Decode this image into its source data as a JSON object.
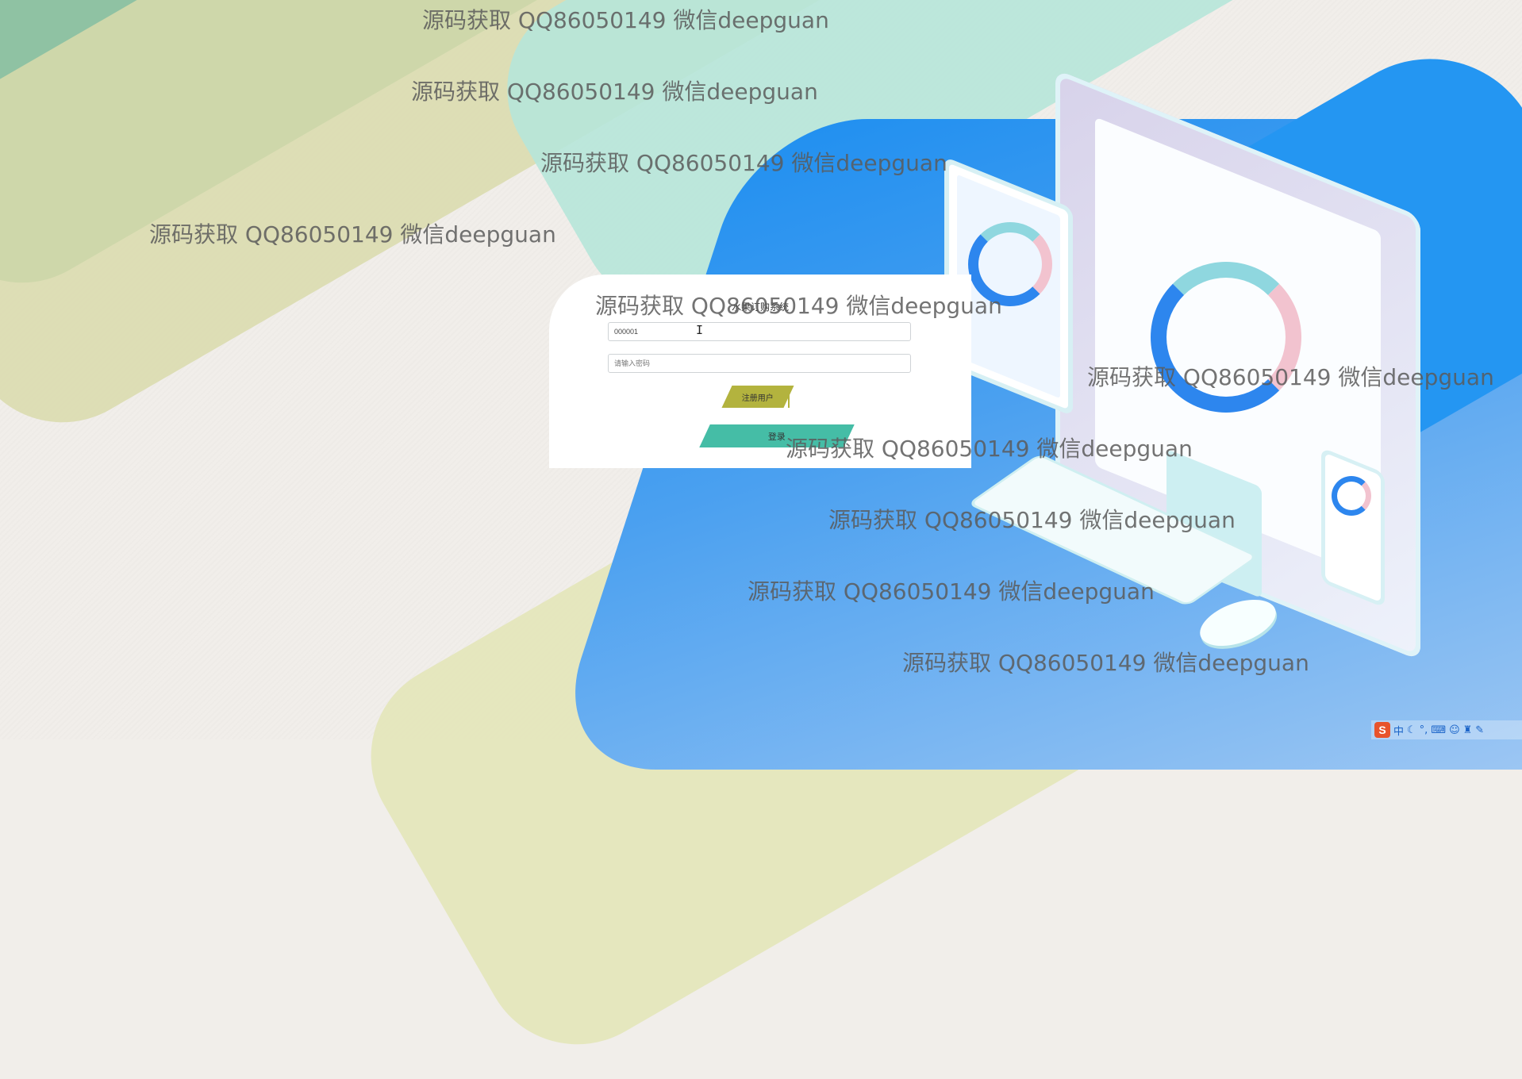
{
  "login": {
    "title": "水果订购系统",
    "username_value": "000001",
    "password_placeholder": "请输入密码",
    "register_label": "注册用户",
    "login_label": "登录"
  },
  "watermark": {
    "text": "源码获取 QQ86050149 微信deepguan"
  },
  "tray": {
    "ime_logo": "S",
    "ime_lang": "中",
    "icons": [
      "moon-icon",
      "punctuation-icon",
      "keyboard-icon",
      "user-icon",
      "shirt-icon",
      "wrench-icon"
    ]
  },
  "colors": {
    "register_button": "#b3b33e",
    "login_button": "#45bda6",
    "primary_blue": "#2496f2"
  }
}
